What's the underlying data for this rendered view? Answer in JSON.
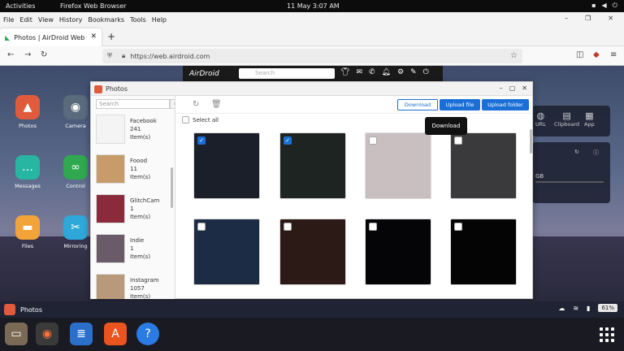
{
  "topbar": {
    "activities": "Activities",
    "app": "Firefox Web Browser",
    "clock": "11 May  3:07 AM"
  },
  "menu": [
    "File",
    "Edit",
    "View",
    "History",
    "Bookmarks",
    "Tools",
    "Help"
  ],
  "tab": {
    "title": "Photos | AirDroid Web"
  },
  "url": {
    "value": "https://web.airdroid.com"
  },
  "airdroid": {
    "logo": "AirDroid",
    "search_placeholder": "Search"
  },
  "desktop": {
    "left_icons": [
      {
        "label": "Photos",
        "color": "#e05b3c"
      },
      {
        "label": "Camera",
        "color": "#5a6b7d"
      },
      {
        "label": "Messages",
        "color": "#26b6a1"
      },
      {
        "label": "Control",
        "color": "#2fa84f"
      },
      {
        "label": "Files",
        "color": "#f2a33a"
      },
      {
        "label": "Mirroring",
        "color": "#2ea8d8"
      }
    ],
    "right_panel": {
      "items": [
        "URL",
        "Clipboard",
        "App"
      ],
      "storage": "GB"
    }
  },
  "window": {
    "title": "Photos",
    "search_placeholder": "Search",
    "albums": [
      {
        "name": "Facebook",
        "count": "241",
        "unit": "Item(s)"
      },
      {
        "name": "Foood",
        "count": "11",
        "unit": "Item(s)"
      },
      {
        "name": "GlitchCam",
        "count": "1",
        "unit": "Item(s)"
      },
      {
        "name": "Indie",
        "count": "1",
        "unit": "Item(s)"
      },
      {
        "name": "Instagram",
        "count": "1057",
        "unit": "Item(s)"
      }
    ],
    "buttons": {
      "download": "Download",
      "upload_file": "Upload file",
      "upload_folder": "Upload folder"
    },
    "select_all": "Select all",
    "tooltip": "Download",
    "photos": [
      {
        "checked": true,
        "bg": "#1a1f2a"
      },
      {
        "checked": true,
        "bg": "#1e2422"
      },
      {
        "checked": false,
        "bg": "#c9bfc0"
      },
      {
        "checked": false,
        "bg": "#3a3a3d"
      },
      {
        "checked": false,
        "bg": "#1c2c44"
      },
      {
        "checked": false,
        "bg": "#2b1a16"
      },
      {
        "checked": false,
        "bg": "#050508"
      },
      {
        "checked": false,
        "bg": "#040404"
      }
    ]
  },
  "taskbar": {
    "app": "Photos",
    "battery": "61%"
  }
}
